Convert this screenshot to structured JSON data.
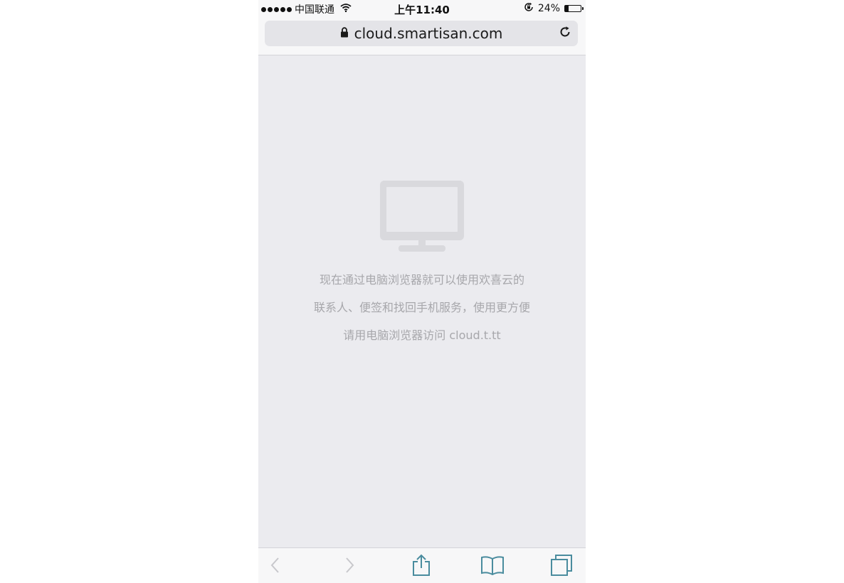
{
  "status_bar": {
    "carrier": "中国联通",
    "time": "上午11:40",
    "battery_percent_label": "24%",
    "battery_level": 0.24
  },
  "address_bar": {
    "url": "cloud.smartisan.com",
    "lock_icon": "lock-icon",
    "reload_icon": "reload-icon"
  },
  "content": {
    "icon": "monitor-icon",
    "lines": [
      "现在通过电脑浏览器就可以使用欢喜云的",
      "联系人、便签和找回手机服务，使用更方便",
      "请用电脑浏览器访问 cloud.t.tt"
    ]
  },
  "toolbar": {
    "items": [
      "back-icon",
      "forward-icon",
      "share-icon",
      "bookmarks-icon",
      "tabs-icon"
    ]
  },
  "colors": {
    "content_bg": "#ebebef",
    "message_text": "#a7a7ab",
    "toolbar_icon": "#4a8c9e",
    "toolbar_icon_disabled": "#c8c8cc"
  }
}
